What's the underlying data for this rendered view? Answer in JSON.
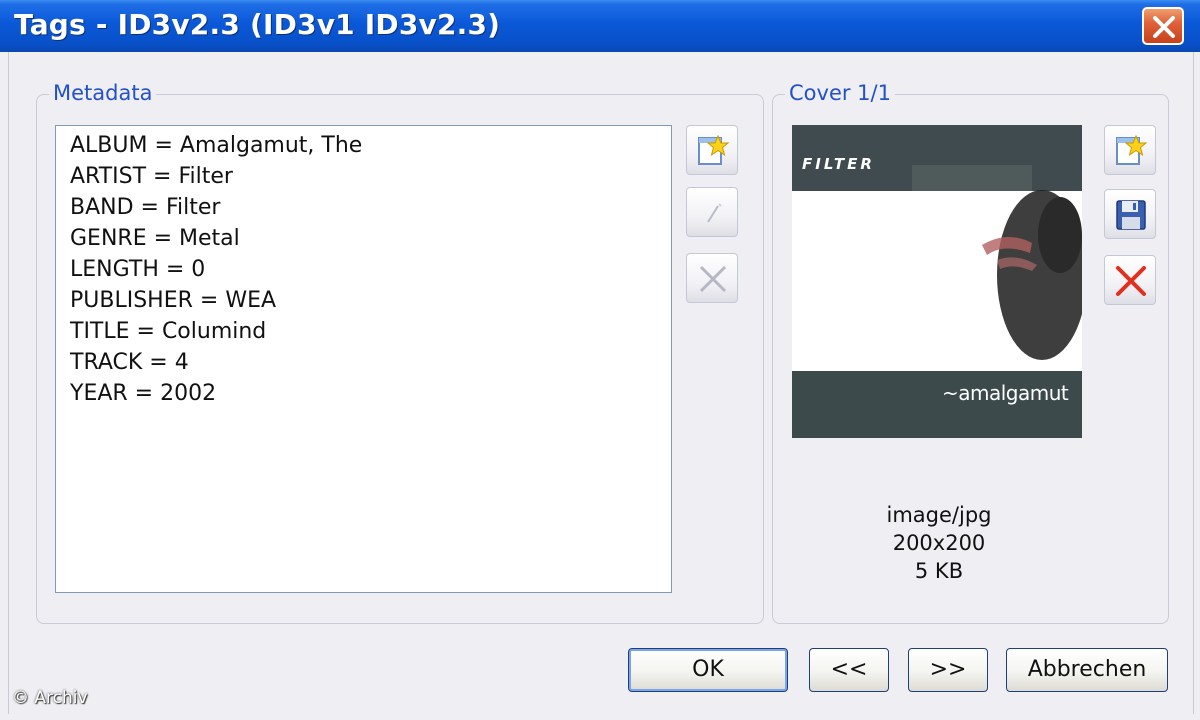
{
  "window": {
    "title": "Tags - ID3v2.3 (ID3v1 ID3v2.3)"
  },
  "metadata": {
    "legend": "Metadata",
    "lines": [
      "ALBUM = Amalgamut, The",
      "ARTIST = Filter",
      "BAND = Filter",
      "GENRE = Metal",
      "LENGTH = 0",
      "PUBLISHER = WEA",
      "TITLE = Columind",
      "TRACK = 4",
      "YEAR = 2002"
    ],
    "tools": [
      "new-tag-icon",
      "edit-tag-icon",
      "delete-tag-icon"
    ]
  },
  "cover": {
    "legend": "Cover 1/1",
    "band_text": "FILTER",
    "album_text": "~amalgamut",
    "mime": "image/jpg",
    "dimensions": "200x200",
    "size": "5 KB",
    "tools": [
      "add-cover-icon",
      "save-cover-icon",
      "remove-cover-icon"
    ]
  },
  "buttons": {
    "ok": "OK",
    "prev": "<<",
    "next": ">>",
    "cancel": "Abbrechen"
  },
  "watermark": "© Archiv",
  "colors": {
    "titlebar": "#0a58d8",
    "legend": "#2451c6",
    "close": "#c8411c",
    "cover_dark": "#3d4a4c"
  }
}
